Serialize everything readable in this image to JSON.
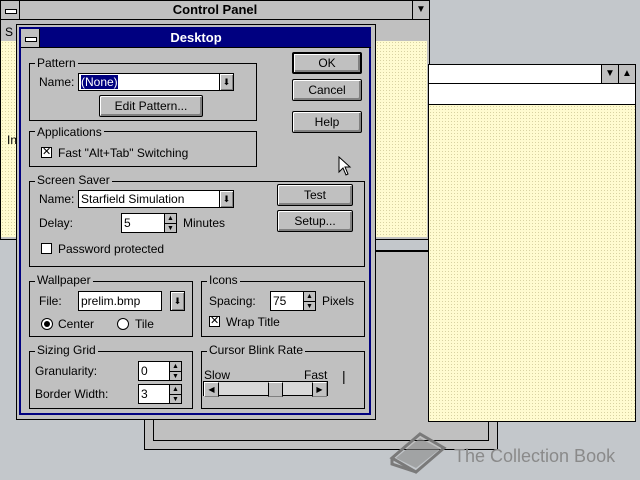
{
  "background_windows": {
    "control_panel": {
      "title": "Control Panel",
      "partial_text_1": "S",
      "partial_text_2": "In"
    },
    "right_window": {
      "title": ""
    }
  },
  "dialog": {
    "title": "Desktop",
    "buttons": {
      "ok": "OK",
      "cancel": "Cancel",
      "help": "Help",
      "test": "Test",
      "setup": "Setup..."
    },
    "pattern": {
      "group_label": "Pattern",
      "name_label": "Name:",
      "name_value": "(None)",
      "edit_button": "Edit Pattern..."
    },
    "applications": {
      "group_label": "Applications",
      "fast_switching_label": "Fast \"Alt+Tab\" Switching",
      "fast_switching_checked": true
    },
    "screen_saver": {
      "group_label": "Screen Saver",
      "name_label": "Name:",
      "name_value": "Starfield Simulation",
      "delay_label": "Delay:",
      "delay_value": "5",
      "delay_unit": "Minutes",
      "password_label": "Password protected",
      "password_checked": false
    },
    "wallpaper": {
      "group_label": "Wallpaper",
      "file_label": "File:",
      "file_value": "prelim.bmp",
      "center_label": "Center",
      "tile_label": "Tile",
      "selected": "Center"
    },
    "icons": {
      "group_label": "Icons",
      "spacing_label": "Spacing:",
      "spacing_value": "75",
      "spacing_unit": "Pixels",
      "wrap_title_label": "Wrap Title",
      "wrap_title_checked": true
    },
    "sizing_grid": {
      "group_label": "Sizing Grid",
      "granularity_label": "Granularity:",
      "granularity_value": "0",
      "border_width_label": "Border Width:",
      "border_width_value": "3"
    },
    "cursor_blink": {
      "group_label": "Cursor Blink Rate",
      "slow_label": "Slow",
      "fast_label": "Fast",
      "cursor_glyph": "|"
    }
  },
  "icons": {
    "dropdown_arrow": "⬇",
    "up_arrow": "▲",
    "down_arrow": "▼",
    "left_arrow": "◀",
    "right_arrow": "▶",
    "check_mark": "✕"
  },
  "watermark": {
    "text": "The Collection Book"
  }
}
